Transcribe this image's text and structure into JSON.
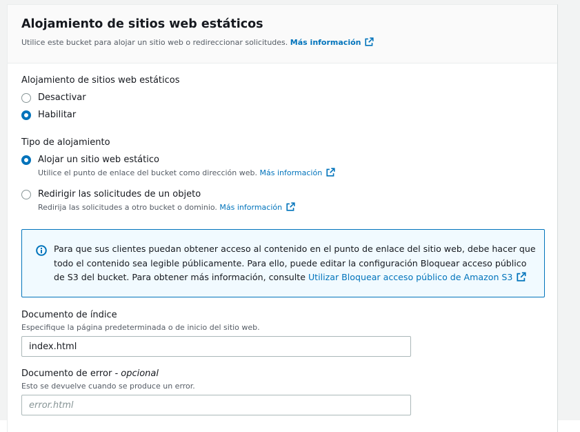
{
  "header": {
    "title": "Alojamiento de sitios web estáticos",
    "description": "Utilice este bucket para alojar un sitio web o redireccionar solicitudes.",
    "more_info_label": "Más información"
  },
  "hosting_toggle": {
    "label": "Alojamiento de sitios web estáticos",
    "options": [
      {
        "label": "Desactivar",
        "selected": false
      },
      {
        "label": "Habilitar",
        "selected": true
      }
    ]
  },
  "hosting_type": {
    "label": "Tipo de alojamiento",
    "options": [
      {
        "label": "Alojar un sitio web estático",
        "description": "Utilice el punto de enlace del bucket como dirección web.",
        "more_info_label": "Más información",
        "selected": true
      },
      {
        "label": "Redirigir las solicitudes de un objeto",
        "description": "Redirija las solicitudes a otro bucket o dominio.",
        "more_info_label": "Más información",
        "selected": false
      }
    ]
  },
  "info_alert": {
    "text": "Para que sus clientes puedan obtener acceso al contenido en el punto de enlace del sitio web, debe hacer que todo el contenido sea legible públicamente. Para ello, puede editar la configuración Bloquear acceso público de S3 del bucket. Para obtener más información, consulte",
    "link_label": "Utilizar Bloquear acceso público de Amazon S3"
  },
  "index_document": {
    "label": "Documento de índice",
    "description": "Especifique la página predeterminada o de inicio del sitio web.",
    "value": "index.html"
  },
  "error_document": {
    "label": "Documento de error",
    "optional_label": "- opcional",
    "description": "Esto se devuelve cuando se produce un error.",
    "value": "",
    "placeholder": "error.html"
  },
  "colors": {
    "accent": "#0073bb",
    "info_background": "#f1faff",
    "header_background": "#fafafa"
  },
  "icons": [
    "external-link-icon",
    "info-icon"
  ]
}
